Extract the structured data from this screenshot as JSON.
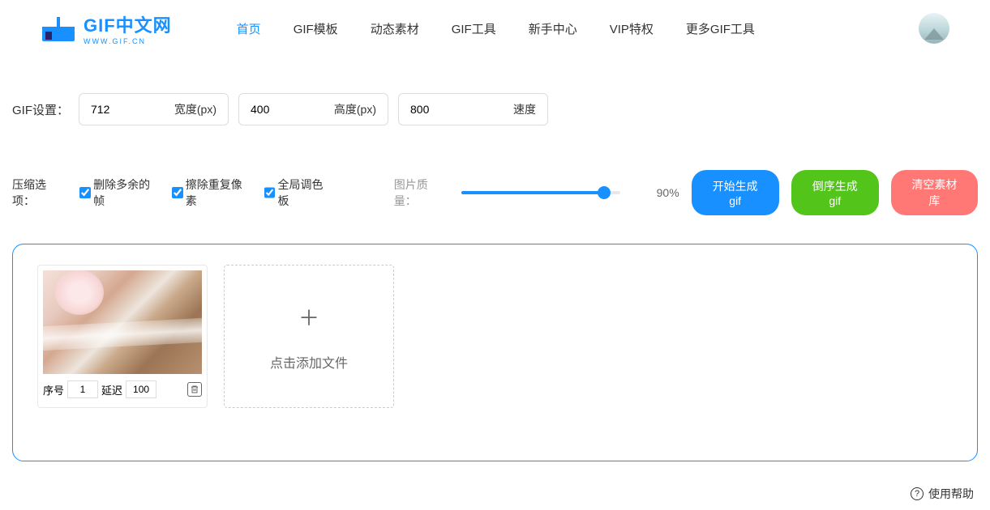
{
  "logo": {
    "title": "GIF中文网",
    "subtitle": "WWW.GIF.CN"
  },
  "nav": {
    "items": [
      "首页",
      "GIF模板",
      "动态素材",
      "GIF工具",
      "新手中心",
      "VIP特权",
      "更多GIF工具"
    ],
    "active_index": 0
  },
  "settings": {
    "label": "GIF设置：",
    "width_value": "712",
    "width_suffix": "宽度(px)",
    "height_value": "400",
    "height_suffix": "高度(px)",
    "speed_value": "800",
    "speed_suffix": "速度"
  },
  "options": {
    "label": "压缩选项：",
    "cb1_label": "删除多余的帧",
    "cb2_label": "擦除重复像素",
    "cb3_label": "全局调色板",
    "quality_label": "图片质量：",
    "quality_percent": "90%"
  },
  "buttons": {
    "start": "开始生成gif",
    "reverse": "倒序生成gif",
    "clear": "清空素材库"
  },
  "thumb": {
    "seq_label": "序号",
    "seq_value": "1",
    "delay_label": "延迟",
    "delay_value": "100"
  },
  "add_card": {
    "text": "点击添加文件"
  },
  "footer": {
    "help": "使用帮助"
  }
}
